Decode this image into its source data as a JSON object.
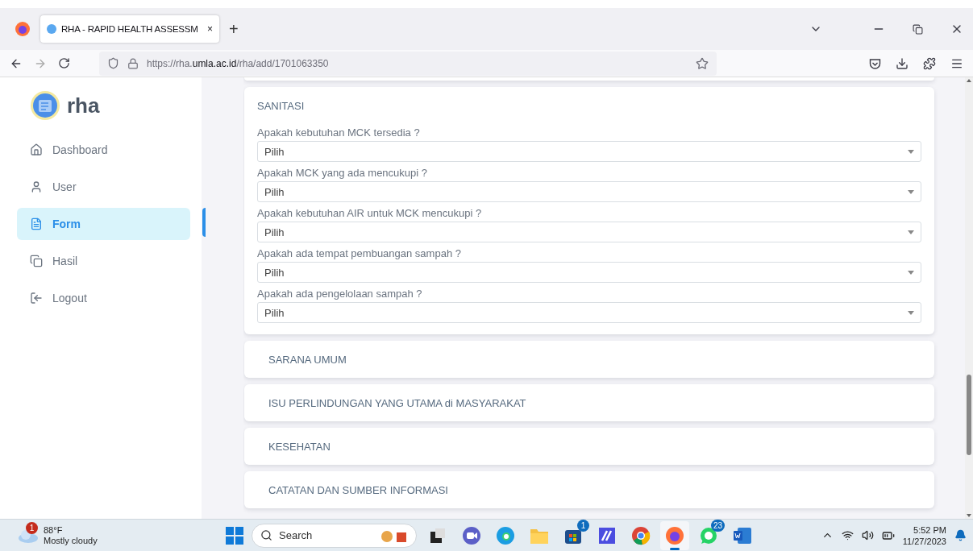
{
  "browser": {
    "tab": {
      "title": "RHA - RAPID HEALTH ASSESSM",
      "close": "×",
      "selected": true
    },
    "new_tab": "+",
    "url": {
      "prefix": "https://rha.",
      "domain": "umla.ac.id",
      "path": "/rha/add/1701063350"
    }
  },
  "sidebar": {
    "logo": "rha",
    "items": [
      {
        "label": "Dashboard",
        "kind": "home",
        "selected": false
      },
      {
        "label": "User",
        "kind": "user",
        "selected": false
      },
      {
        "label": "Form",
        "kind": "form",
        "selected": true
      },
      {
        "label": "Hasil",
        "kind": "copy",
        "selected": false
      },
      {
        "label": "Logout",
        "kind": "logout",
        "selected": false
      }
    ]
  },
  "sanitasi": {
    "title": "SANITASI",
    "questions": [
      {
        "label": "Apakah kebutuhan MCK tersedia ?",
        "value": "Pilih"
      },
      {
        "label": "Apakah MCK yang ada mencukupi ?",
        "value": "Pilih"
      },
      {
        "label": "Apakah kebutuhan AIR untuk MCK mencukupi ?",
        "value": "Pilih"
      },
      {
        "label": "Apakah ada tempat pembuangan sampah ?",
        "value": "Pilih"
      },
      {
        "label": "Apakah ada pengelolaan sampah ?",
        "value": "Pilih"
      }
    ]
  },
  "sections": [
    {
      "title": "SARANA UMUM"
    },
    {
      "title": "ISU PERLINDUNGAN YANG UTAMA di MASYARAKAT"
    },
    {
      "title": "KESEHATAN"
    },
    {
      "title": "CATATAN DAN SUMBER INFORMASI"
    }
  ],
  "taskbar": {
    "weather": {
      "badge": "1",
      "temp": "88°F",
      "desc": "Mostly cloudy"
    },
    "search": "Search",
    "apps": [
      {
        "kind": "files",
        "selected": false
      },
      {
        "kind": "meet",
        "selected": false
      },
      {
        "kind": "edge",
        "selected": false
      },
      {
        "kind": "folder",
        "selected": false
      },
      {
        "kind": "store",
        "badge": "1",
        "selected": false
      },
      {
        "kind": "maze",
        "selected": false
      },
      {
        "kind": "chrome",
        "selected": false
      },
      {
        "kind": "firefox",
        "selected": true
      },
      {
        "kind": "whatsapp",
        "badge": "23",
        "selected": false
      },
      {
        "kind": "word",
        "selected": false
      }
    ],
    "time": "5:52 PM",
    "date": "11/27/2023"
  }
}
